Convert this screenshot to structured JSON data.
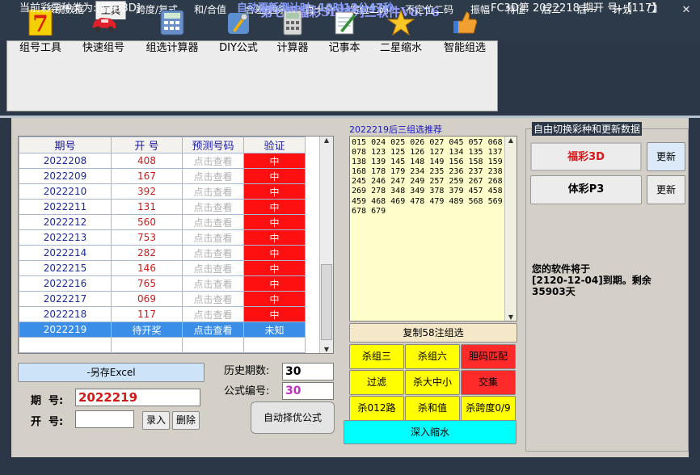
{
  "window": {
    "title": "第七感福彩3D排列三软件V8.76",
    "min": "−",
    "max": "❐",
    "close": "✕"
  },
  "menu": [
    "系统数据",
    "工具",
    "跨度/复式",
    "和/合值",
    "合差/通杀",
    "百十个",
    "定位二码",
    "不定位二码",
    "振幅",
    "特征",
    "后二",
    "后一",
    "计划"
  ],
  "toolbar": [
    "组号工具",
    "快速组号",
    "组选计算器",
    "DIY公式",
    "计算器",
    "记事本",
    "二星缩水",
    "智能组选"
  ],
  "table": {
    "headers": [
      "期号",
      "开  号",
      "预测号码",
      "验证"
    ],
    "rows": [
      {
        "id": "2022208",
        "num": "408",
        "pred": "点击查看",
        "ver": "中"
      },
      {
        "id": "2022209",
        "num": "167",
        "pred": "点击查看",
        "ver": "中"
      },
      {
        "id": "2022210",
        "num": "392",
        "pred": "点击查看",
        "ver": "中"
      },
      {
        "id": "2022211",
        "num": "131",
        "pred": "点击查看",
        "ver": "中"
      },
      {
        "id": "2022212",
        "num": "560",
        "pred": "点击查看",
        "ver": "中"
      },
      {
        "id": "2022213",
        "num": "753",
        "pred": "点击查看",
        "ver": "中"
      },
      {
        "id": "2022214",
        "num": "282",
        "pred": "点击查看",
        "ver": "中"
      },
      {
        "id": "2022215",
        "num": "146",
        "pred": "点击查看",
        "ver": "中"
      },
      {
        "id": "2022216",
        "num": "765",
        "pred": "点击查看",
        "ver": "中"
      },
      {
        "id": "2022217",
        "num": "069",
        "pred": "点击查看",
        "ver": "中"
      },
      {
        "id": "2022218",
        "num": "117",
        "pred": "点击查看",
        "ver": "中"
      },
      {
        "id": "2022219",
        "num": "待开奖",
        "pred": "点击查看",
        "ver": "未知"
      }
    ]
  },
  "recommend": {
    "title": "2022219后三组选推荐",
    "numbers": "015 024 025 026 027 045 057 068 078 123 125 126 127 134 135 137 138 139 145 148 149 156 158 159 168 178 179 234 235 236 237 238 245 246 247 249 257 259 267 268 269 278 348 349 378 379 457 458 459 468 469 478 479 489 568 569 678 679",
    "copy": "复制58注组选"
  },
  "filters": [
    "杀组三",
    "杀组六",
    "胆码匹配",
    "过滤",
    "杀大中小",
    "交集",
    "杀012路",
    "杀和值",
    "杀跨度0/9"
  ],
  "deep": "深入缩水",
  "switch": {
    "title": "自由切换彩种和更新数据",
    "fc": "福彩3D",
    "tc": "体彩P3",
    "update": "更新"
  },
  "expire": {
    "line1": "您的软件将于",
    "line2": "[2120-12-04]到期。剩余",
    "line3": "35903天"
  },
  "form": {
    "export": "-另存Excel",
    "history_label": "历史期数:",
    "history_value": "30",
    "formula_label": "公式编号:",
    "formula_value": "30",
    "period_label": "期  号:",
    "period_value": "2022219",
    "open_label": "开  号:",
    "open_value": "",
    "enter": "录入",
    "delete": "删除",
    "auto": "自动择优公式"
  },
  "status": {
    "type": "当前彩票种类为:[福彩3D]",
    "countdown": "自动更新倒计时:  10时12分47秒",
    "period": "FC3D第 2022218 期开  号:【117】"
  },
  "colors": {
    "accent": "#3a8ee8",
    "red": "#ff1010",
    "yellow": "#ffff00",
    "cyan": "#00ffff"
  }
}
